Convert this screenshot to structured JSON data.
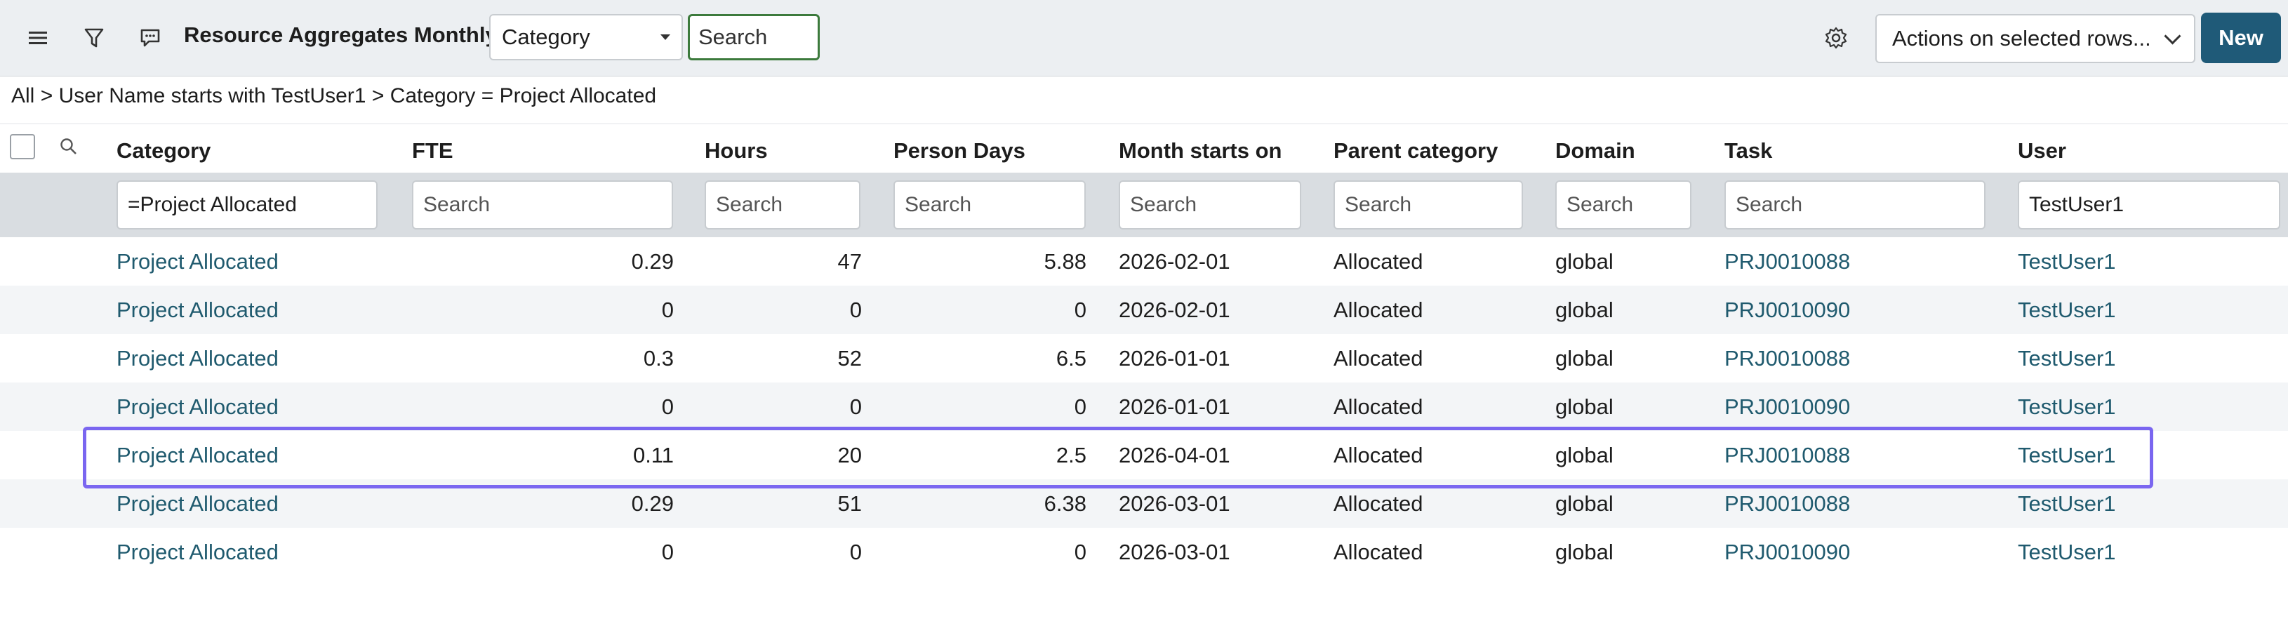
{
  "header": {
    "title": "Resource Aggregates Monthly",
    "field_select": "Category",
    "search_value": "Search",
    "actions_select": "Actions on selected rows...",
    "new_label": "New"
  },
  "breadcrumb": {
    "all": "All",
    "sep1": ">",
    "filter1": "User Name starts with TestUser1",
    "sep2": ">",
    "filter2": "Category = Project Allocated"
  },
  "columns": [
    "Category",
    "FTE",
    "Hours",
    "Person Days",
    "Month starts on",
    "Parent category",
    "Domain",
    "Task",
    "User"
  ],
  "filters": {
    "category": "=Project Allocated",
    "fte": "",
    "hours": "",
    "person_days": "",
    "month": "",
    "parent": "",
    "domain": "",
    "task": "",
    "user": "TestUser1",
    "placeholder": "Search"
  },
  "rows": [
    {
      "category": "Project Allocated",
      "fte": "0.29",
      "hours": "47",
      "person_days": "5.88",
      "month": "2026-02-01",
      "parent": "Allocated",
      "domain": "global",
      "task": "PRJ0010088",
      "user": "TestUser1"
    },
    {
      "category": "Project Allocated",
      "fte": "0",
      "hours": "0",
      "person_days": "0",
      "month": "2026-02-01",
      "parent": "Allocated",
      "domain": "global",
      "task": "PRJ0010090",
      "user": "TestUser1"
    },
    {
      "category": "Project Allocated",
      "fte": "0.3",
      "hours": "52",
      "person_days": "6.5",
      "month": "2026-01-01",
      "parent": "Allocated",
      "domain": "global",
      "task": "PRJ0010088",
      "user": "TestUser1"
    },
    {
      "category": "Project Allocated",
      "fte": "0",
      "hours": "0",
      "person_days": "0",
      "month": "2026-01-01",
      "parent": "Allocated",
      "domain": "global",
      "task": "PRJ0010090",
      "user": "TestUser1"
    },
    {
      "category": "Project Allocated",
      "fte": "0.11",
      "hours": "20",
      "person_days": "2.5",
      "month": "2026-04-01",
      "parent": "Allocated",
      "domain": "global",
      "task": "PRJ0010088",
      "user": "TestUser1"
    },
    {
      "category": "Project Allocated",
      "fte": "0.29",
      "hours": "51",
      "person_days": "6.38",
      "month": "2026-03-01",
      "parent": "Allocated",
      "domain": "global",
      "task": "PRJ0010088",
      "user": "TestUser1"
    },
    {
      "category": "Project Allocated",
      "fte": "0",
      "hours": "0",
      "person_days": "0",
      "month": "2026-03-01",
      "parent": "Allocated",
      "domain": "global",
      "task": "PRJ0010090",
      "user": "TestUser1"
    }
  ],
  "colors": {
    "accent": "#1f5a78",
    "link": "#1f5a6e",
    "highlight": "#7a66f0",
    "search_focus": "#3c7a3c"
  },
  "icons": [
    "menu-icon",
    "filter-icon",
    "chat-icon",
    "gear-icon",
    "chevron-down-icon",
    "search-icon"
  ]
}
